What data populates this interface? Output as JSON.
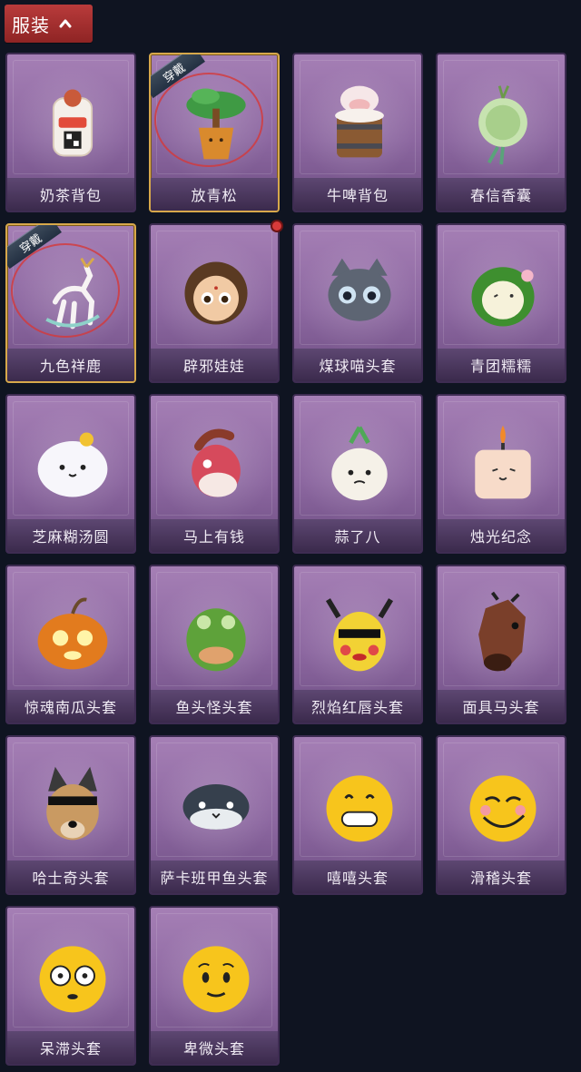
{
  "header": {
    "title": "服装"
  },
  "badges": {
    "equipped": "穿戴"
  },
  "items": [
    {
      "label": "奶茶背包",
      "icon": "milk-tea-backpack-icon",
      "equipped": false
    },
    {
      "label": "放青松",
      "icon": "pine-bonsai-icon",
      "equipped": true
    },
    {
      "label": "牛啤背包",
      "icon": "cow-beer-backpack-icon",
      "equipped": false
    },
    {
      "label": "春信香囊",
      "icon": "spring-sachet-icon",
      "equipped": false
    },
    {
      "label": "九色祥鹿",
      "icon": "nine-color-deer-icon",
      "equipped": true
    },
    {
      "label": "辟邪娃娃",
      "icon": "doll-head-icon",
      "equipped": false,
      "new": true
    },
    {
      "label": "煤球喵头套",
      "icon": "black-cat-head-icon",
      "equipped": false
    },
    {
      "label": "青团糯糯",
      "icon": "green-rice-ball-icon",
      "equipped": false
    },
    {
      "label": "芝麻糊汤圆",
      "icon": "sesame-dumpling-icon",
      "equipped": false
    },
    {
      "label": "马上有钱",
      "icon": "red-horse-head-icon",
      "equipped": false
    },
    {
      "label": "蒜了八",
      "icon": "garlic-head-icon",
      "equipped": false
    },
    {
      "label": "烛光纪念",
      "icon": "candle-head-icon",
      "equipped": false
    },
    {
      "label": "惊魂南瓜头套",
      "icon": "pumpkin-head-icon",
      "equipped": false
    },
    {
      "label": "鱼头怪头套",
      "icon": "fish-head-icon",
      "equipped": false
    },
    {
      "label": "烈焰红唇头套",
      "icon": "yellow-mouse-head-icon",
      "equipped": false
    },
    {
      "label": "面具马头套",
      "icon": "horse-mask-icon",
      "equipped": false
    },
    {
      "label": "哈士奇头套",
      "icon": "husky-head-icon",
      "equipped": false
    },
    {
      "label": "萨卡班甲鱼头套",
      "icon": "armored-fish-head-icon",
      "equipped": false
    },
    {
      "label": "嘻嘻头套",
      "icon": "grin-emoji-head-icon",
      "equipped": false
    },
    {
      "label": "滑稽头套",
      "icon": "funny-emoji-head-icon",
      "equipped": false
    },
    {
      "label": "呆滞头套",
      "icon": "dazed-emoji-head-icon",
      "equipped": false
    },
    {
      "label": "卑微头套",
      "icon": "humble-emoji-head-icon",
      "equipped": false
    }
  ],
  "colors": {
    "background": "#0f1421",
    "card": "#8c67a0",
    "header": "#b93b3b",
    "equipped_border": "#d7a84b"
  }
}
